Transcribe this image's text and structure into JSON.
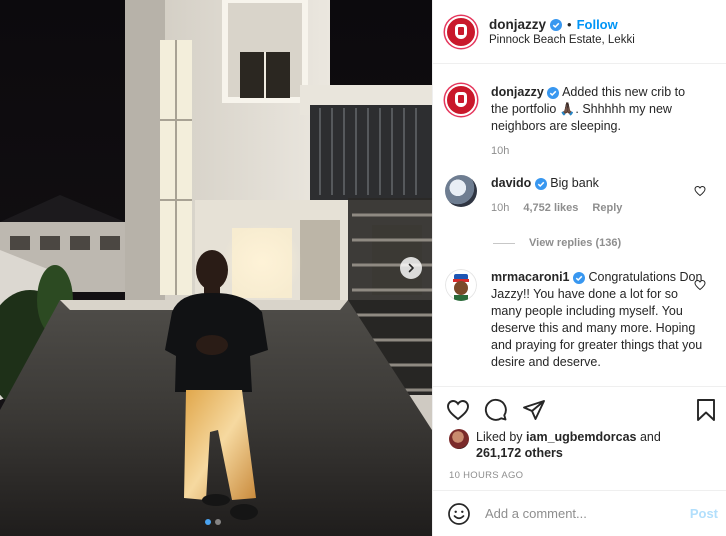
{
  "post": {
    "username": "donjazzy",
    "follow_label": "Follow",
    "separator": "•",
    "location": "Pinnock Beach Estate, Lekki"
  },
  "caption": {
    "username": "donjazzy",
    "text_before": "Added this new crib to the portfolio ",
    "emoji": "🙏🏿",
    "text_after": ". Shhhhh my new neighbors are sleeping.",
    "time": "10h"
  },
  "comments": [
    {
      "username": "davido",
      "text": "Big bank",
      "time": "10h",
      "likes": "4,752 likes",
      "reply_label": "Reply",
      "view_replies": "View replies (136)"
    },
    {
      "username": "mrmacaroni1",
      "text": "Congratulations Don Jazzy!! You have done a lot for so many people including myself. You deserve this and many more. Hoping and praying for greater things that you desire and deserve."
    }
  ],
  "likes": {
    "prefix": "Liked by ",
    "user": "iam_ugbemdorcas",
    "middle": " and",
    "others": "261,172 others"
  },
  "timestamp": "10 HOURS AGO",
  "add_comment": {
    "placeholder": "Add a comment...",
    "post_label": "Post"
  },
  "carousel": {
    "total": 2,
    "active_index": 0
  },
  "colors": {
    "accent": "#0095f6",
    "verified": "#3897f0",
    "post_disabled": "#b2dffc",
    "muted": "#8e8e8e",
    "active_dot": "#4aa3f0"
  },
  "icons": {
    "like": "heart-icon",
    "comment": "comment-icon",
    "share": "paper-plane-icon",
    "save": "bookmark-icon",
    "emoji": "smiley-icon",
    "next": "chevron-right-icon",
    "verified": "verified-badge-icon"
  }
}
